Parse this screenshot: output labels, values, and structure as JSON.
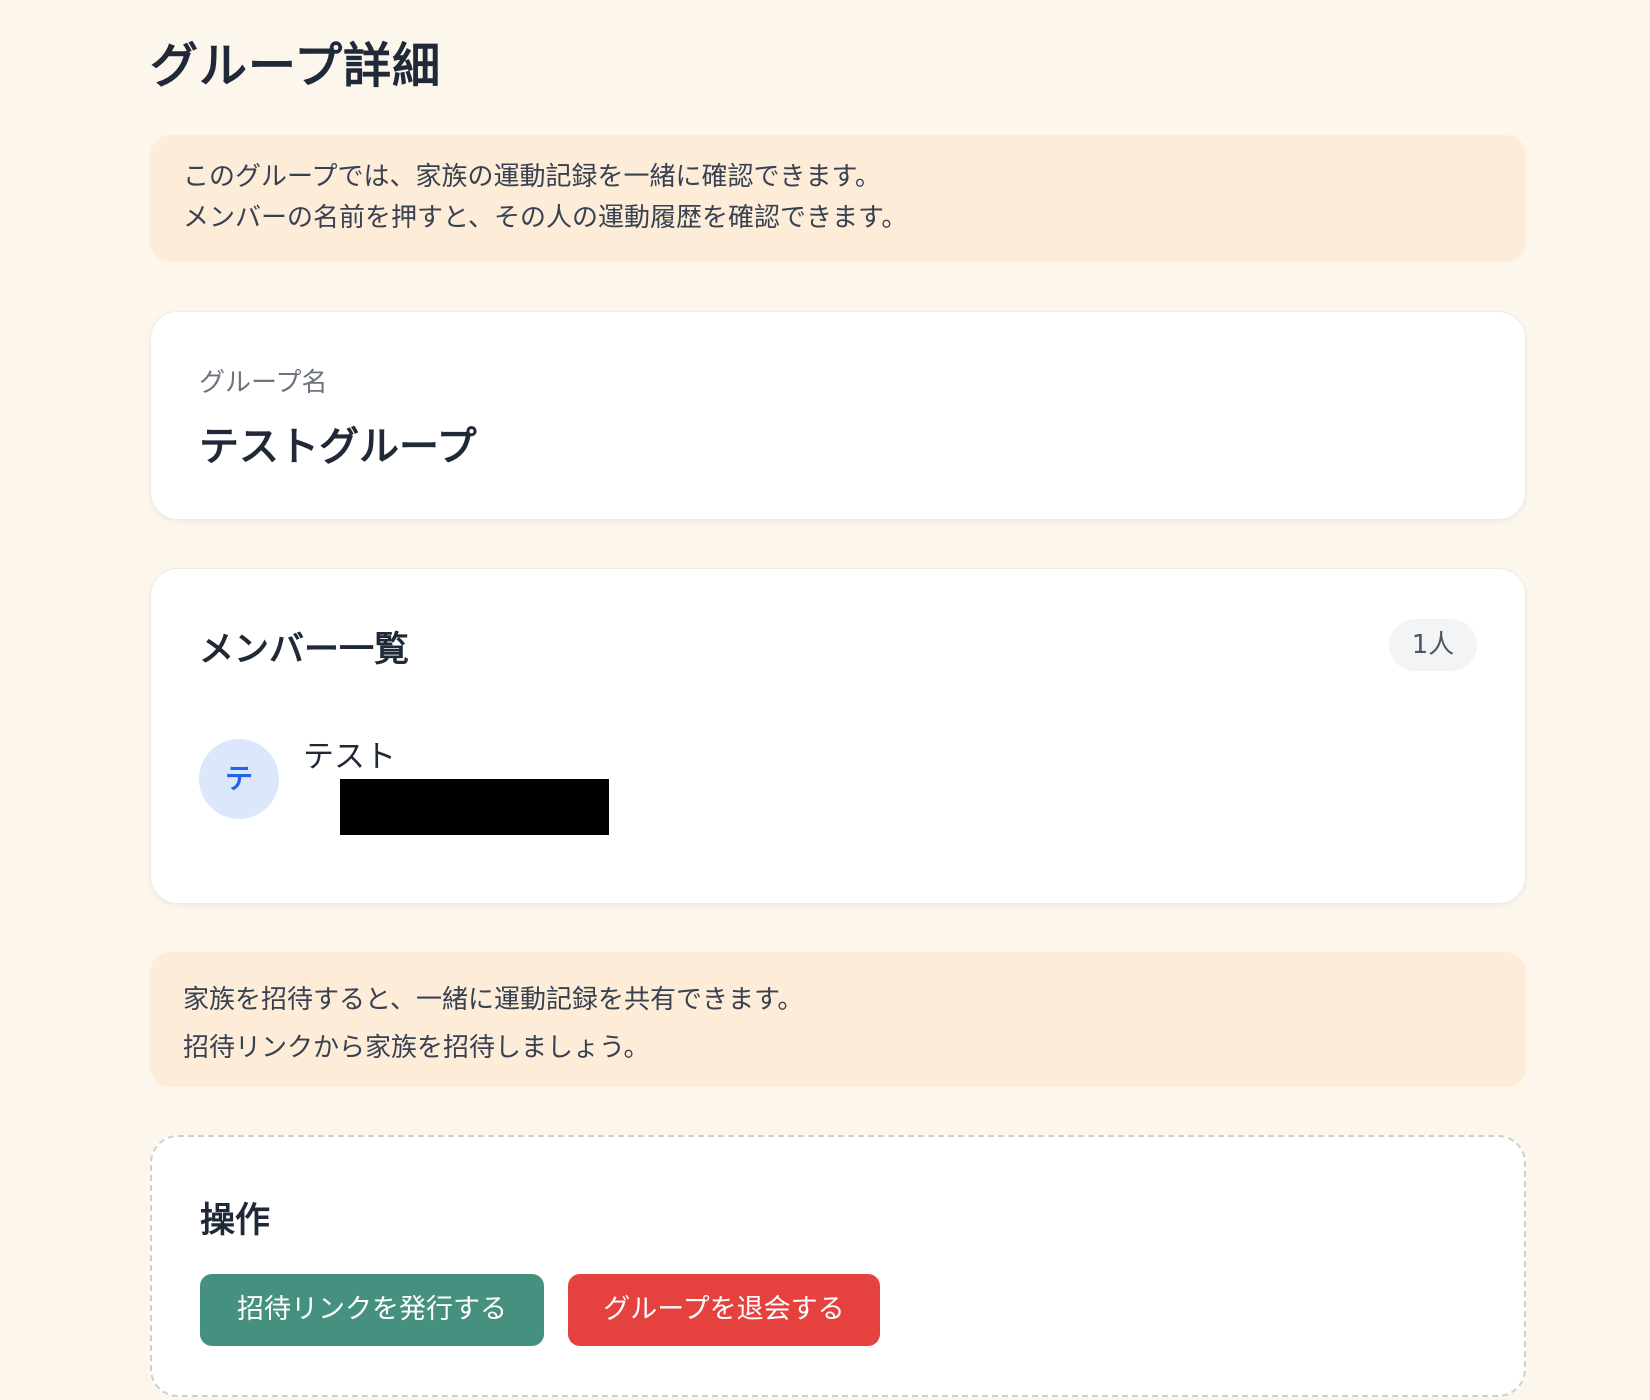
{
  "page": {
    "title": "グループ詳細"
  },
  "intro_notice": {
    "line1": "このグループでは、家族の運動記録を一緒に確認できます。",
    "line2": "メンバーの名前を押すと、その人の運動履歴を確認できます。"
  },
  "group": {
    "name_label": "グループ名",
    "name": "テストグループ"
  },
  "members": {
    "title": "メンバー一覧",
    "count": "1人",
    "items": [
      {
        "avatar_initial": "テ",
        "name": "テスト",
        "detail_redacted": true
      }
    ]
  },
  "invite_notice": {
    "line1": "家族を招待すると、一緒に運動記録を共有できます。",
    "line2": "招待リンクから家族を招待しましょう。"
  },
  "actions": {
    "title": "操作",
    "invite_button": "招待リンクを発行する",
    "leave_button": "グループを退会する"
  },
  "colors": {
    "background": "#fdf6ec",
    "notice_background": "#fdedd8",
    "invite_button": "#45907f",
    "leave_button": "#e5413f",
    "avatar_background": "#dbe7fb",
    "avatar_text": "#2563eb"
  }
}
